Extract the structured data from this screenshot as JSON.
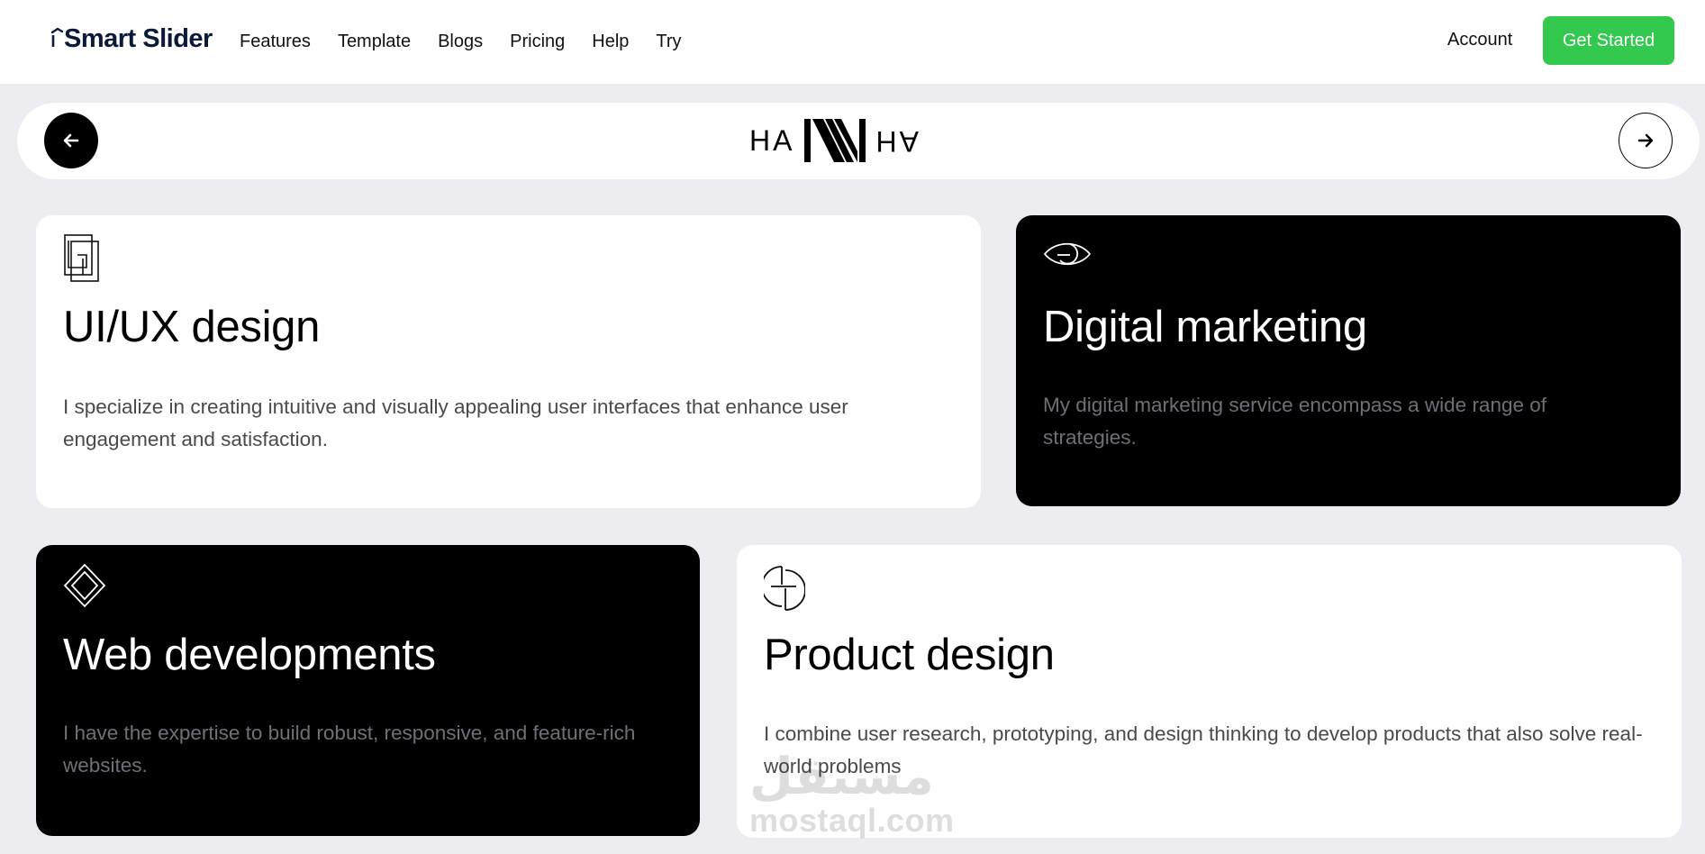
{
  "nav": {
    "logo": "Smart Slider",
    "items": [
      "Features",
      "Template",
      "Blogs",
      "Pricing",
      "Help",
      "Try"
    ],
    "account": "Account",
    "cta": "Get Started",
    "cta_color": "#33c84e"
  },
  "slider": {
    "brand_left": "HA",
    "brand_right": "HA",
    "prev_icon": "arrow-left-icon",
    "next_icon": "arrow-right-icon"
  },
  "cards": [
    {
      "title": "UI/UX design",
      "description": "I specialize in creating intuitive and visually appealing user interfaces that enhance user engagement and satisfaction.",
      "icon": "layers-square-icon",
      "theme": "light"
    },
    {
      "title": "Digital marketing",
      "description": "My digital marketing service encompass a wide range of strategies.",
      "icon": "eye-icon",
      "theme": "dark"
    },
    {
      "title": "Web developments",
      "description": "I have the expertise to build robust, responsive, and feature-rich websites.",
      "icon": "diamond-icon",
      "theme": "dark"
    },
    {
      "title": "Product design",
      "description": "I combine user research, prototyping, and design thinking to develop products that also solve real-world problems",
      "icon": "split-circle-icon",
      "theme": "light"
    }
  ],
  "watermark": {
    "arabic": "مستقل",
    "latin": "mostaql.com"
  }
}
